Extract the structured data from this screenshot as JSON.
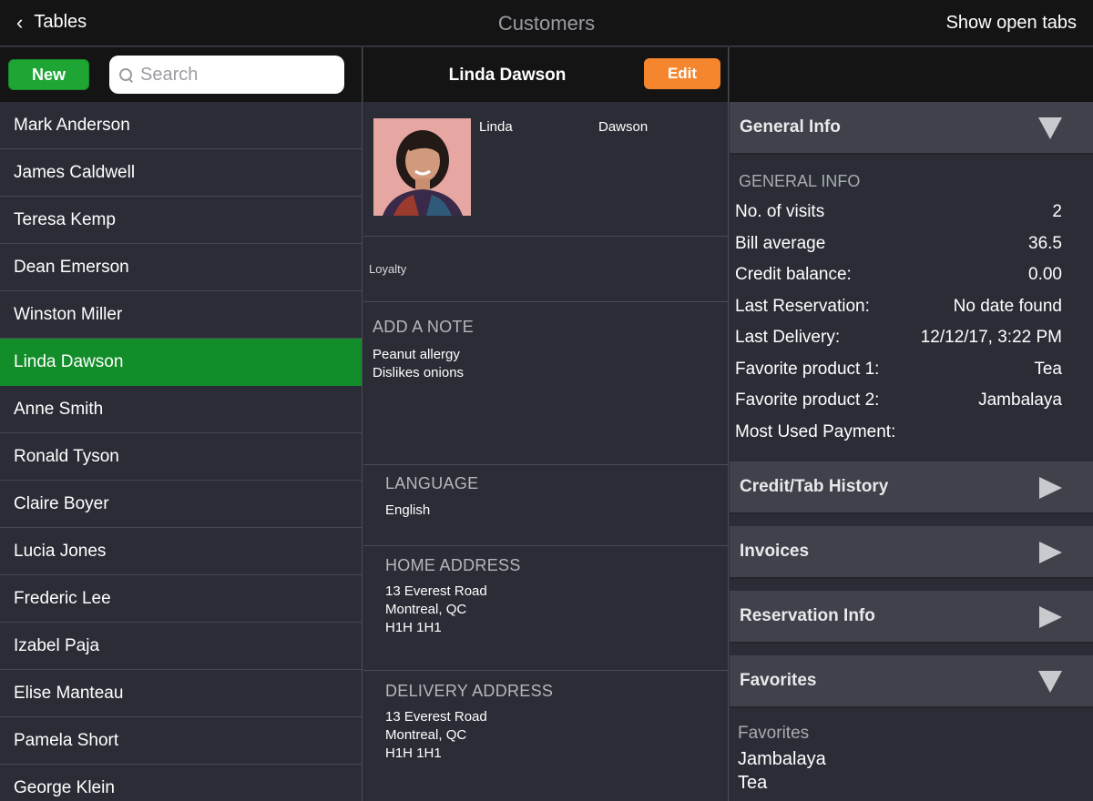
{
  "topbar": {
    "back_label": "Tables",
    "title": "Customers",
    "open_tabs_label": "Show open tabs"
  },
  "left": {
    "new_label": "New",
    "search_placeholder": "Search",
    "customers": [
      "Mark Anderson",
      "James Caldwell",
      "Teresa Kemp",
      "Dean Emerson",
      "Winston Miller",
      "Linda Dawson",
      "Anne Smith",
      "Ronald Tyson",
      "Claire Boyer",
      "Lucia Jones",
      "Frederic Lee",
      "Izabel Paja",
      "Elise Manteau",
      "Pamela Short",
      "George Klein"
    ],
    "selected_index": 5
  },
  "detail": {
    "name": "Linda Dawson",
    "edit_label": "Edit",
    "first_name": "Linda",
    "last_name": "Dawson",
    "loyalty_label": "Loyalty",
    "note_title": "ADD A NOTE",
    "note_lines": [
      "Peanut allergy",
      "Dislikes onions"
    ],
    "language_title": "LANGUAGE",
    "language": "English",
    "home_title": "HOME ADDRESS",
    "home_lines": [
      "13 Everest Road",
      "Montreal, QC",
      "H1H 1H1"
    ],
    "delivery_title": "DELIVERY ADDRESS",
    "delivery_lines": [
      "13 Everest Road",
      "Montreal, QC",
      "H1H 1H1"
    ]
  },
  "info": {
    "general_header": "General Info",
    "general_title": "GENERAL INFO",
    "rows": [
      {
        "label": "No. of visits",
        "value": "2"
      },
      {
        "label": "Bill average",
        "value": "36.5"
      },
      {
        "label": "Credit balance:",
        "value": "0.00"
      },
      {
        "label": "Last Reservation:",
        "value": "No date found"
      },
      {
        "label": "Last Delivery:",
        "value": "12/12/17, 3:22 PM"
      },
      {
        "label": "Favorite product 1:",
        "value": "Tea"
      },
      {
        "label": "Favorite product 2:",
        "value": "Jambalaya"
      },
      {
        "label": "Most Used Payment:",
        "value": ""
      }
    ],
    "credit_header": "Credit/Tab History",
    "invoices_header": "Invoices",
    "reservation_header": "Reservation Info",
    "favorites_header": "Favorites",
    "favorites_title": "Favorites",
    "favorites": [
      "Jambalaya",
      "Tea"
    ]
  },
  "colors": {
    "new_button": "#1ea534",
    "selected_row": "#138d2a",
    "edit_button": "#f5862d"
  }
}
